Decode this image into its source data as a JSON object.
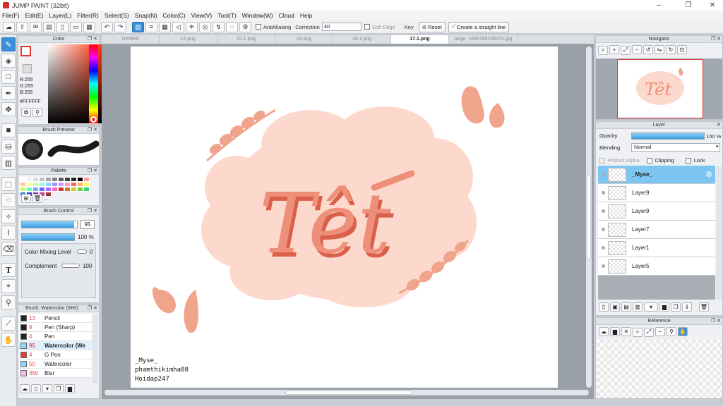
{
  "window": {
    "title": "JUMP PAINT (32bit)",
    "minimize": "–",
    "restore": "❐",
    "close": "✕"
  },
  "menu": [
    "File(F)",
    "Edit(E)",
    "Layer(L)",
    "Filter(R)",
    "Select(S)",
    "Snap(N)",
    "Color(C)",
    "View(V)",
    "Tool(T)",
    "Window(W)",
    "Cloud",
    "Help"
  ],
  "toolbar": {
    "antialiasing_label": "AntiAliasing",
    "correction_label": "Correction",
    "correction_value": "40",
    "soft_edge_label": "Soft Edge",
    "key_label": "Key",
    "reset_label": "Reset",
    "straight_line_label": "Create a straight line"
  },
  "tabs": [
    "Untitled",
    "15.png",
    "15.1.png",
    "16.png",
    "16.1.png",
    "17.1.png",
    "large_1636765228375.jpg"
  ],
  "active_tab": "17.1.png",
  "color_panel": {
    "title": "Color",
    "r": "R:255",
    "g": "G:255",
    "b": "B:255",
    "hex": "#FFFFFF"
  },
  "brush_preview": {
    "title": "Brush Preview"
  },
  "palette": {
    "title": "Palette",
    "more": "...",
    "colors": [
      "#ffffff",
      "#f2f2f2",
      "#d9d9d9",
      "#bfbfbf",
      "#a6a6a6",
      "#808080",
      "#595959",
      "#404040",
      "#262626",
      "#000000",
      "#ff9999",
      "#ffcc99",
      "#ffff99",
      "#ccff99",
      "#99ffcc",
      "#99ccff",
      "#9999ff",
      "#cc99ff",
      "#ff99cc",
      "#ff6666",
      "#ffb366",
      "#ffff66",
      "#b3ff66",
      "#66ffb3",
      "#66b3ff",
      "#6666ff",
      "#b366ff",
      "#ff66b3",
      "#cc3333",
      "#cc7a33",
      "#cccc33",
      "#7acc33",
      "#33cc7a",
      "#337acc",
      "#3333cc",
      "#7a33cc",
      "#cc337a",
      "#993333"
    ]
  },
  "brush_control": {
    "title": "Brush Control",
    "size_value": "95",
    "size_fraction": 0.95,
    "opacity_value": "100 %",
    "opacity_fraction": 1.0,
    "mixing_label": "Color Mixing Level",
    "mixing_value": "0",
    "complement_label": "Complement",
    "complement_value": "100"
  },
  "brush_list": {
    "title": "Brush: Watercolor (Wet)",
    "items": [
      {
        "size": "13",
        "name": "Pencil",
        "color": "#222222"
      },
      {
        "size": "8",
        "name": "Pen (Sharp)",
        "color": "#222222"
      },
      {
        "size": "4",
        "name": "Pen",
        "color": "#222222"
      },
      {
        "size": "95",
        "name": "Watercolor (We",
        "color": "#8fd3ff",
        "selected": true
      },
      {
        "size": "4",
        "name": "G Pen",
        "color": "#e53935"
      },
      {
        "size": "50",
        "name": "Watercolor",
        "color": "#8fd3ff"
      },
      {
        "size": "360",
        "name": "Blur",
        "color": "#f8b7e6"
      }
    ]
  },
  "canvas": {
    "title_text": "Têt",
    "caption": [
      "_Myse_",
      "phamthikimha08",
      "Hoidap247"
    ],
    "colors": {
      "cloud": "#fcd9cc",
      "lettering": "#ee8f7a",
      "lettering_shadow": "#d9604b",
      "branch": "#f0a48c"
    }
  },
  "navigator": {
    "title": "Navigator"
  },
  "layer_panel": {
    "title": "Layer",
    "opacity_label": "Opacity",
    "opacity_value": "100 %",
    "blending_label": "Blending",
    "blending_value": "Normal",
    "protect_alpha": "Protect Alpha",
    "clipping": "Clipping",
    "lock": "Lock",
    "layers": [
      {
        "name": "_Myse_",
        "selected": true
      },
      {
        "name": "Layer9"
      },
      {
        "name": "Layer9"
      },
      {
        "name": "Layer7"
      },
      {
        "name": "Layer1"
      },
      {
        "name": "Layer5"
      }
    ]
  },
  "reference": {
    "title": "Reference"
  }
}
